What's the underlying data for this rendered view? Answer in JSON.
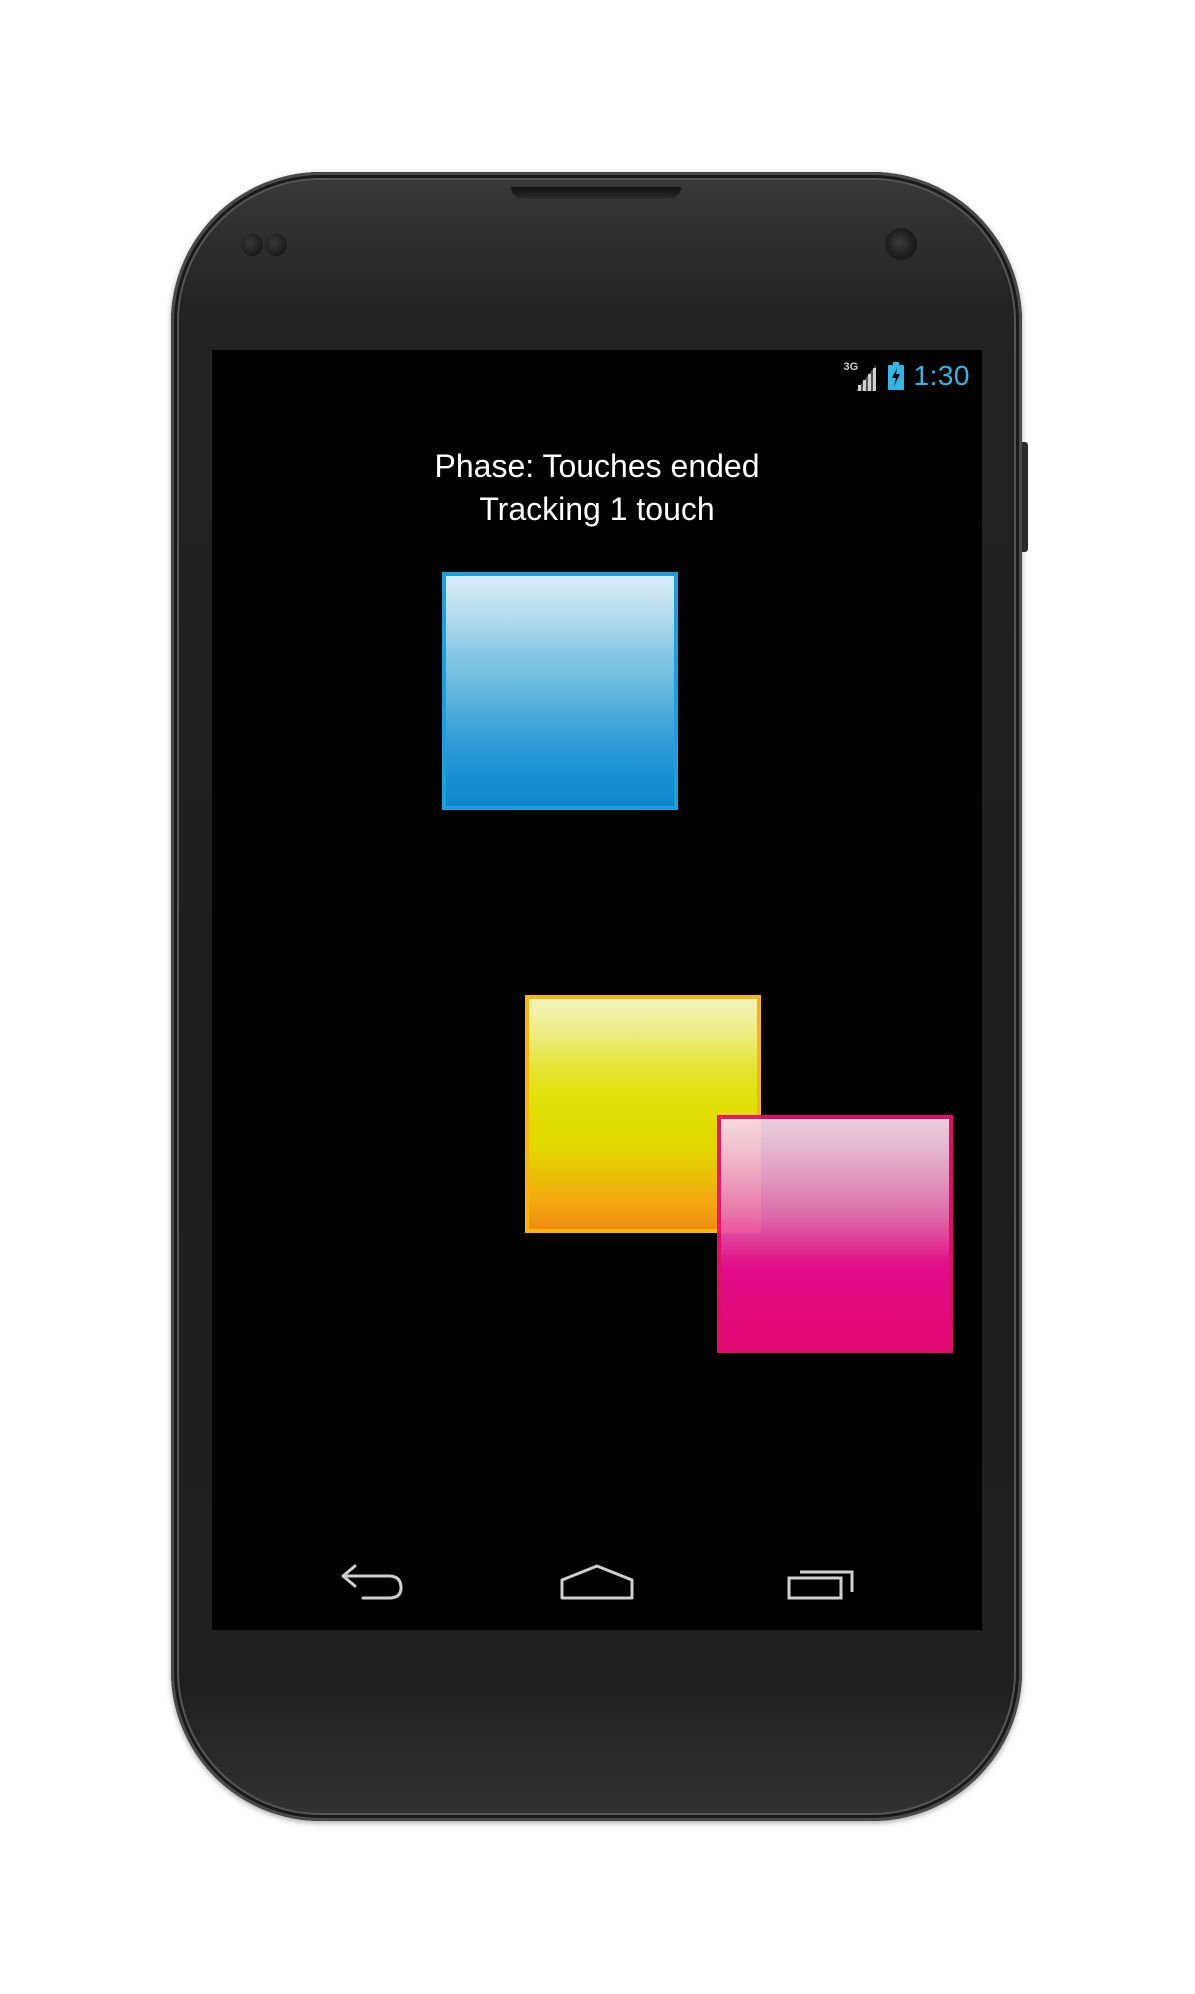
{
  "status_bar": {
    "network_type": "3G",
    "signal_icon": "signal-bars-icon",
    "battery_icon": "battery-charging-icon",
    "clock": "1:30",
    "accent_color": "#33b5e5"
  },
  "touch_info": {
    "phase_text": "Phase: Touches ended",
    "tracking_text": "Tracking 1 touch"
  },
  "squares": [
    {
      "name": "blue-square",
      "color": "#1aa0df"
    },
    {
      "name": "yellow-square",
      "color": "#f6b60e"
    },
    {
      "name": "pink-square",
      "color": "#ea0f6e"
    }
  ],
  "navigation": {
    "back_icon": "back-arrow-icon",
    "home_icon": "home-icon",
    "recents_icon": "recent-apps-icon"
  }
}
